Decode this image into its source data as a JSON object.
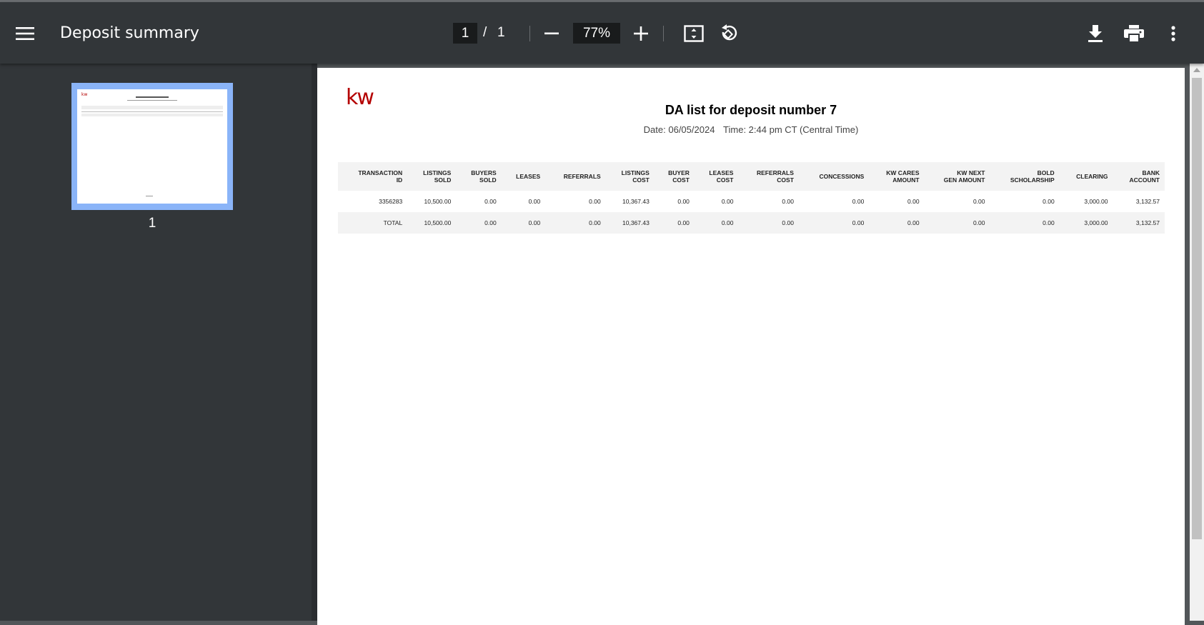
{
  "toolbar": {
    "title": "Deposit summary",
    "current_page": "1",
    "page_separator": "/",
    "total_pages": "1",
    "zoom": "77%"
  },
  "sidebar": {
    "thumbnail_page_number": "1"
  },
  "document": {
    "logo_text": "kw",
    "title": "DA list for deposit number 7",
    "date": "Date: 06/05/2024",
    "time": "Time: 2:44 pm CT (Central Time)",
    "columns": [
      [
        "TRANSACTION",
        "ID"
      ],
      [
        "LISTINGS",
        "SOLD"
      ],
      [
        "BUYERS",
        "SOLD"
      ],
      [
        "LEASES",
        ""
      ],
      [
        "REFERRALS",
        ""
      ],
      [
        "LISTINGS",
        "COST"
      ],
      [
        "BUYER",
        "COST"
      ],
      [
        "LEASES",
        "COST"
      ],
      [
        "REFERRALS",
        "COST"
      ],
      [
        "CONCESSIONS",
        ""
      ],
      [
        "KW CARES",
        "AMOUNT"
      ],
      [
        "KW NEXT",
        "GEN AMOUNT"
      ],
      [
        "BOLD",
        "SCHOLARSHIP"
      ],
      [
        "CLEARING",
        ""
      ],
      [
        "BANK",
        "ACCOUNT"
      ]
    ],
    "rows": [
      [
        "3356283",
        "10,500.00",
        "0.00",
        "0.00",
        "0.00",
        "10,367.43",
        "0.00",
        "0.00",
        "0.00",
        "0.00",
        "0.00",
        "0.00",
        "0.00",
        "3,000.00",
        "3,132.57"
      ]
    ],
    "total_row": [
      "TOTAL",
      "10,500.00",
      "0.00",
      "0.00",
      "0.00",
      "10,367.43",
      "0.00",
      "0.00",
      "0.00",
      "0.00",
      "0.00",
      "0.00",
      "0.00",
      "3,000.00",
      "3,132.57"
    ]
  },
  "icons": {
    "menu": "menu-icon",
    "zoom_out": "minus-icon",
    "zoom_in": "plus-icon",
    "fit": "fit-to-page-icon",
    "rotate": "rotate-icon",
    "download": "download-icon",
    "print": "print-icon",
    "more": "more-vert-icon"
  }
}
